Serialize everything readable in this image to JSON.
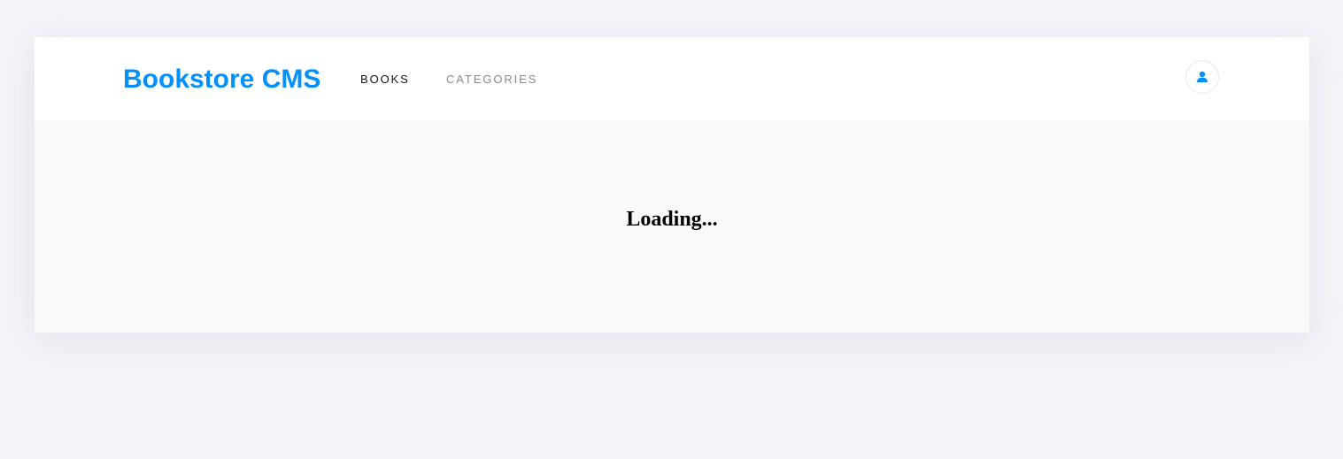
{
  "header": {
    "brand": "Bookstore CMS",
    "nav": [
      {
        "label": "BOOKS",
        "active": true
      },
      {
        "label": "CATEGORIES",
        "active": false
      }
    ],
    "avatar_icon": "user-icon"
  },
  "main": {
    "status_text": "Loading..."
  },
  "colors": {
    "brand": "#0290ff",
    "nav_active": "#121212",
    "nav_inactive": "#8a8a8a",
    "page_background": "#f4f5f9",
    "panel_background": "#f9f9f9",
    "header_background": "#ffffff"
  }
}
